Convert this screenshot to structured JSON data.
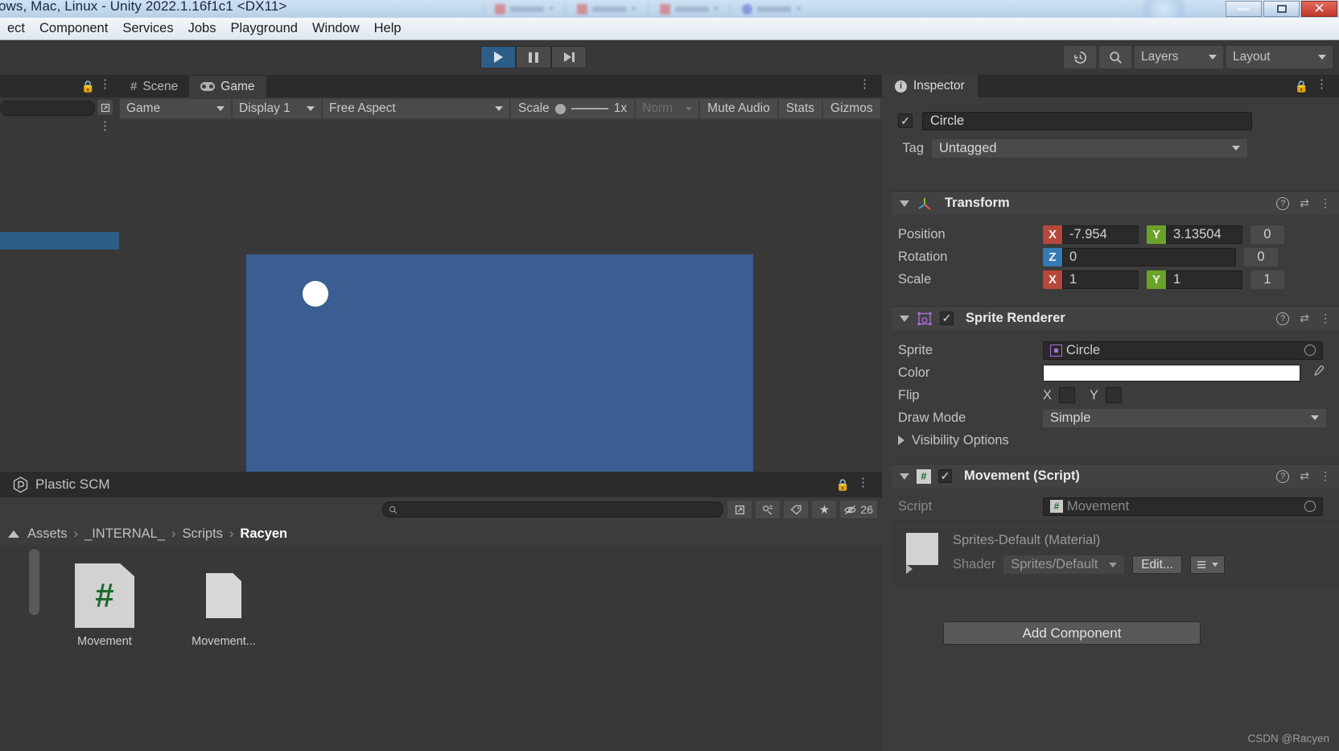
{
  "window": {
    "title": "ows, Mac, Linux - Unity 2022.1.16f1c1 <DX11>",
    "minimize_label": "–",
    "maximize_label": "▣",
    "close_label": "✕"
  },
  "menubar": {
    "items": [
      "ect",
      "Component",
      "Services",
      "Jobs",
      "Playground",
      "Window",
      "Help"
    ]
  },
  "toolbar": {
    "play_icon": "play-icon",
    "pause_icon": "pause-icon",
    "step_icon": "step-icon",
    "history_icon": "history-icon",
    "search_icon": "search-icon",
    "layers_label": "Layers",
    "layout_label": "Layout"
  },
  "hierarchy": {
    "lock_icon": "lock-icon",
    "kebab_icon": "kebab-menu-icon",
    "picker_icon": "object-picker-icon"
  },
  "game_panel": {
    "tabs": [
      {
        "label": "Scene",
        "icon": "scene-grid-icon",
        "active": false
      },
      {
        "label": "Game",
        "icon": "gamepad-icon",
        "active": true
      }
    ],
    "kebab_icon": "kebab-menu-icon",
    "toolbar": {
      "target_display": "Game",
      "display": "Display 1",
      "aspect": "Free Aspect",
      "scale_label": "Scale",
      "scale_value": "1x",
      "norm_label": "Norm",
      "mute_audio_label": "Mute Audio",
      "stats_label": "Stats",
      "gizmos_label": "Gizmos"
    },
    "canvas": {
      "background_color": "#3a5e91",
      "sprite_color": "#ffffff",
      "sprite_name": "circle-sprite"
    }
  },
  "project_panel": {
    "tab_label": "Plastic SCM",
    "tab_icon": "plastic-scm-icon",
    "lock_icon": "lock-icon",
    "kebab_icon": "kebab-menu-icon",
    "search_placeholder": "",
    "search_value": "",
    "search_icon": "search-icon",
    "toolbar_icons": [
      "object-picker-icon",
      "filter-type-icon",
      "filter-label-icon",
      "favorites-star-icon"
    ],
    "hidden_count_label": "26",
    "hidden_count_icon": "eye-slash-icon",
    "breadcrumb": [
      "Assets",
      "_INTERNAL_",
      "Scripts",
      "Racyen"
    ],
    "breadcrumb_separator": "›",
    "assets": [
      {
        "label": "Movement",
        "icon": "csharp-script-icon",
        "glyph": "#"
      },
      {
        "label": "Movement...",
        "icon": "text-file-icon",
        "glyph": ""
      }
    ]
  },
  "inspector": {
    "tab_label": "Inspector",
    "tab_icon": "info-icon",
    "lock_icon": "lock-icon",
    "kebab_icon": "kebab-menu-icon",
    "object": {
      "enabled": true,
      "name": "Circle",
      "tag_label": "Tag",
      "tag_value": "Untagged"
    },
    "transform": {
      "title": "Transform",
      "icon": "transform-axis-icon",
      "rows": [
        {
          "label": "Position",
          "x": "-7.954",
          "y": "3.13504",
          "z": "0"
        },
        {
          "label": "Rotation",
          "x": "",
          "y": "",
          "z": "0",
          "z_first": "0"
        },
        {
          "label": "Scale",
          "x": "1",
          "y": "1",
          "z": "1"
        }
      ],
      "position": {
        "label": "Position",
        "x": "-7.954",
        "y": "3.13504",
        "z": "0"
      },
      "rotation": {
        "label": "Rotation",
        "z_axis": "Z",
        "z_value": "0",
        "far_value": "0"
      },
      "scale": {
        "label": "Scale",
        "x": "1",
        "y": "1",
        "z": "1"
      }
    },
    "sprite_renderer": {
      "title": "Sprite Renderer",
      "icon": "sprite-renderer-icon",
      "enabled": true,
      "sprite_label": "Sprite",
      "sprite_value": "Circle",
      "color_label": "Color",
      "color_value": "#ffffff",
      "eyedropper_icon": "eyedropper-icon",
      "flip_label": "Flip",
      "flip_x_label": "X",
      "flip_y_label": "Y",
      "flip_x": false,
      "flip_y": false,
      "draw_mode_label": "Draw Mode",
      "draw_mode_value": "Simple",
      "visibility_options_label": "Visibility Options"
    },
    "movement_script": {
      "title": "Movement (Script)",
      "icon": "csharp-script-icon",
      "enabled": true,
      "script_label": "Script",
      "script_value": "Movement"
    },
    "material": {
      "title": "Sprites-Default (Material)",
      "shader_label": "Shader",
      "shader_value": "Sprites/Default",
      "edit_button_label": "Edit...",
      "preset_icon": "preset-list-icon"
    },
    "add_component_label": "Add Component"
  },
  "watermark": "CSDN @Racyen",
  "colors": {
    "panel_bg": "#383838",
    "panel_alt": "#3c3c3c",
    "tab_bar": "#2b2b2b",
    "accent_blue": "#2c5d87",
    "axis_x": "#b8473b",
    "axis_y": "#6aa329",
    "axis_z": "#3579b5"
  }
}
